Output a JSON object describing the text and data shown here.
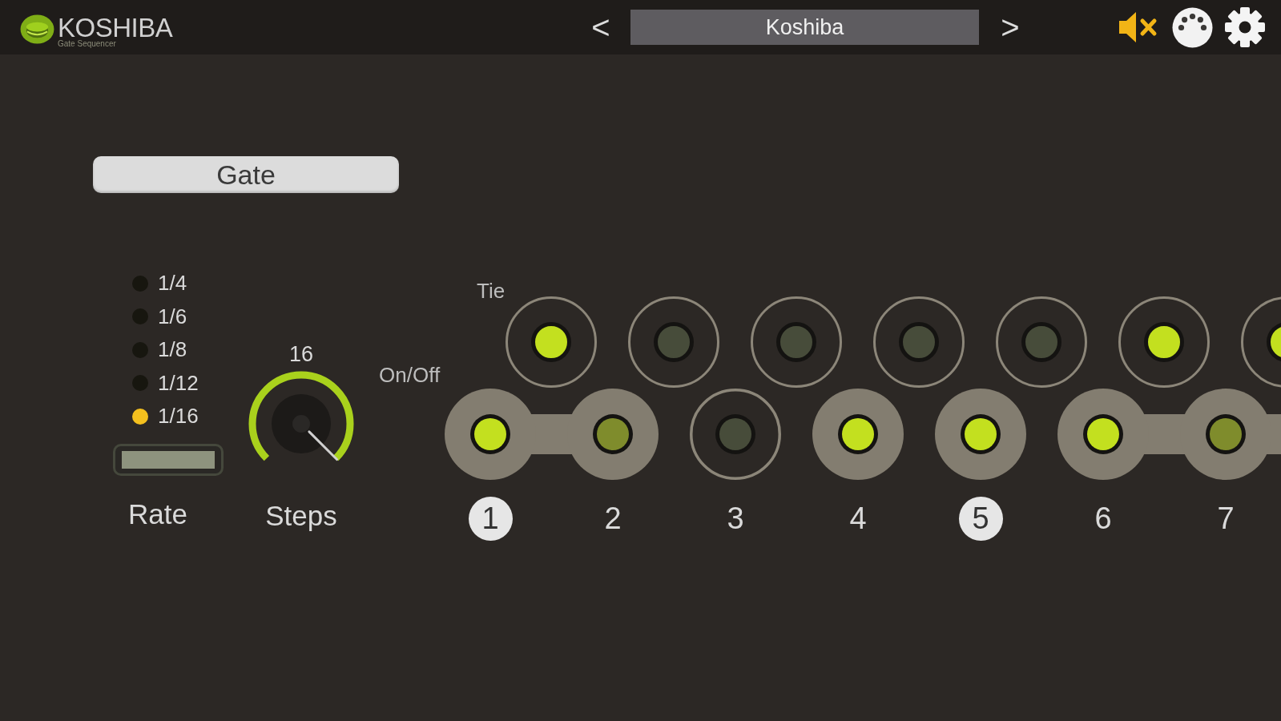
{
  "header": {
    "logo": {
      "name": "KOSHIBA",
      "subtitle": "Gate Sequencer"
    },
    "preset": {
      "prev": "<",
      "name": "Koshiba",
      "next": ">"
    },
    "muted": true
  },
  "mode_button": {
    "label": "Gate"
  },
  "rate": {
    "options": [
      {
        "label": "1/4",
        "selected": false
      },
      {
        "label": "1/6",
        "selected": false
      },
      {
        "label": "1/8",
        "selected": false
      },
      {
        "label": "1/12",
        "selected": false
      },
      {
        "label": "1/16",
        "selected": true
      }
    ],
    "label": "Rate"
  },
  "steps_knob": {
    "value": "16",
    "level": 1,
    "label": "Steps"
  },
  "sequencer": {
    "tie_label": "Tie",
    "onoff_label": "On/Off",
    "ties": [
      {
        "on": true
      },
      {
        "on": false
      },
      {
        "on": false
      },
      {
        "on": false
      },
      {
        "on": false
      },
      {
        "on": true
      },
      {
        "on": true
      }
    ],
    "steps": [
      {
        "number": "1",
        "on": true,
        "highlighted": true
      },
      {
        "number": "2",
        "on": true,
        "highlighted": false
      },
      {
        "number": "3",
        "on": false,
        "highlighted": false
      },
      {
        "number": "4",
        "on": true,
        "highlighted": false
      },
      {
        "number": "5",
        "on": true,
        "highlighted": true
      },
      {
        "number": "6",
        "on": true,
        "highlighted": false
      },
      {
        "number": "7",
        "on": true,
        "highlighted": false
      }
    ]
  }
}
